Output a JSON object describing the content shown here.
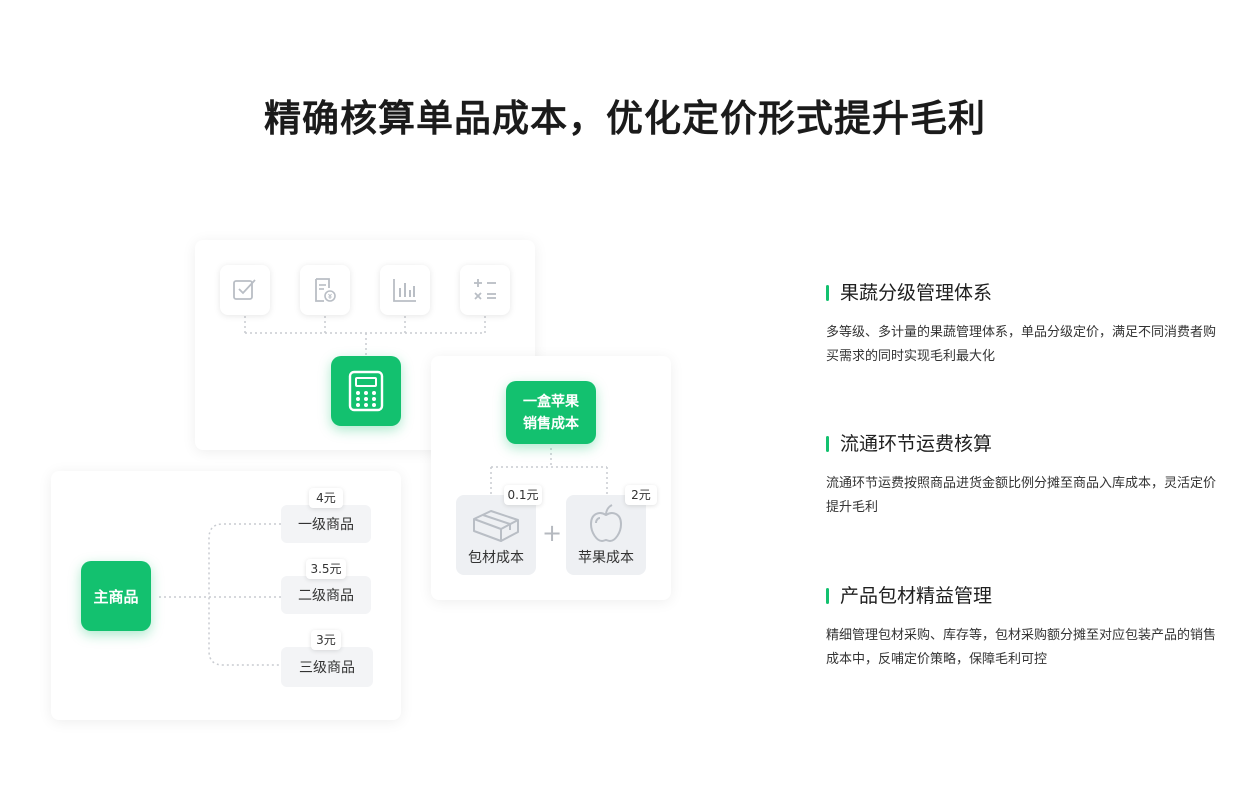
{
  "header": {
    "title": "精确核算单品成本，优化定价形式提升毛利"
  },
  "diagram": {
    "calculator_card": {
      "icons": [
        "checkbox-icon",
        "receipt-icon",
        "bar-chart-icon",
        "math-operators-icon"
      ],
      "center_icon": "calculator-icon"
    },
    "apple_cost_card": {
      "main_label_line1": "一盒苹果",
      "main_label_line2": "销售成本",
      "packaging": {
        "label": "包材成本",
        "price": "0.1元",
        "icon": "box-icon"
      },
      "apple": {
        "label": "苹果成本",
        "price": "2元",
        "icon": "apple-icon"
      },
      "operator": "+"
    },
    "product_tree_card": {
      "main_label": "主商品",
      "grades": [
        {
          "label": "一级商品",
          "price": "4元"
        },
        {
          "label": "二级商品",
          "price": "3.5元"
        },
        {
          "label": "三级商品",
          "price": "3元"
        }
      ]
    }
  },
  "features": [
    {
      "title": "果蔬分级管理体系",
      "desc": "多等级、多计量的果蔬管理体系，单品分级定价，满足不同消费者购买需求的同时实现毛利最大化"
    },
    {
      "title": "流通环节运费核算",
      "desc": "流通环节运费按照商品进货金额比例分摊至商品入库成本，灵活定价提升毛利"
    },
    {
      "title": "产品包材精益管理",
      "desc": "精细管理包材采购、库存等，包材采购额分摊至对应包装产品的销售成本中，反哺定价策略，保障毛利可控"
    }
  ],
  "colors": {
    "accent": "#13c16f",
    "icon_stroke": "#b9bec5"
  }
}
